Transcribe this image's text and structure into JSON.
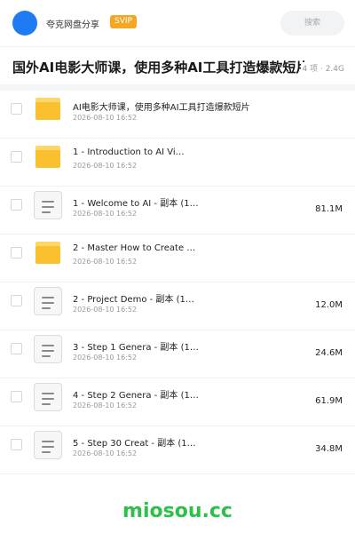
{
  "header": {
    "username": "夸克网盘分享",
    "badge": "SVIP",
    "search_placeholder": "搜索",
    "brand_color": "#1f7bf2"
  },
  "folder": {
    "title": "国外AI电影大师课，使用多种AI工具打造爆款短片",
    "meta": "4 项 · 2.4G"
  },
  "items": [
    {
      "type": "folder",
      "name": "AI电影大师课，使用多种AI工具打造爆款短片",
      "date": "2026-08-10 16:52",
      "size": ""
    },
    {
      "type": "folder",
      "name": "1 - Introduction to AI Vi…",
      "date": "2026-08-10 16:52",
      "size": ""
    },
    {
      "type": "file",
      "name": "1 - Welcome to AI - 副本 (1…",
      "date": "2026-08-10 16:52",
      "size": "81.1M"
    },
    {
      "type": "folder",
      "name": "2 - Master How to Create …",
      "date": "2026-08-10 16:52",
      "size": ""
    },
    {
      "type": "file",
      "name": "2 - Project Demo  - 副本 (1…",
      "date": "2026-08-10 16:52",
      "size": "12.0M"
    },
    {
      "type": "file",
      "name": "3 - Step 1 Genera - 副本 (1…",
      "date": "2026-08-10 16:52",
      "size": "24.6M"
    },
    {
      "type": "file",
      "name": "4 - Step 2 Genera - 副本 (1…",
      "date": "2026-08-10 16:52",
      "size": "61.9M"
    },
    {
      "type": "file",
      "name": "5 - Step 30 Creat - 副本 (1…",
      "date": "2026-08-10 16:52",
      "size": "34.8M"
    }
  ],
  "watermark": "miosou.cc"
}
